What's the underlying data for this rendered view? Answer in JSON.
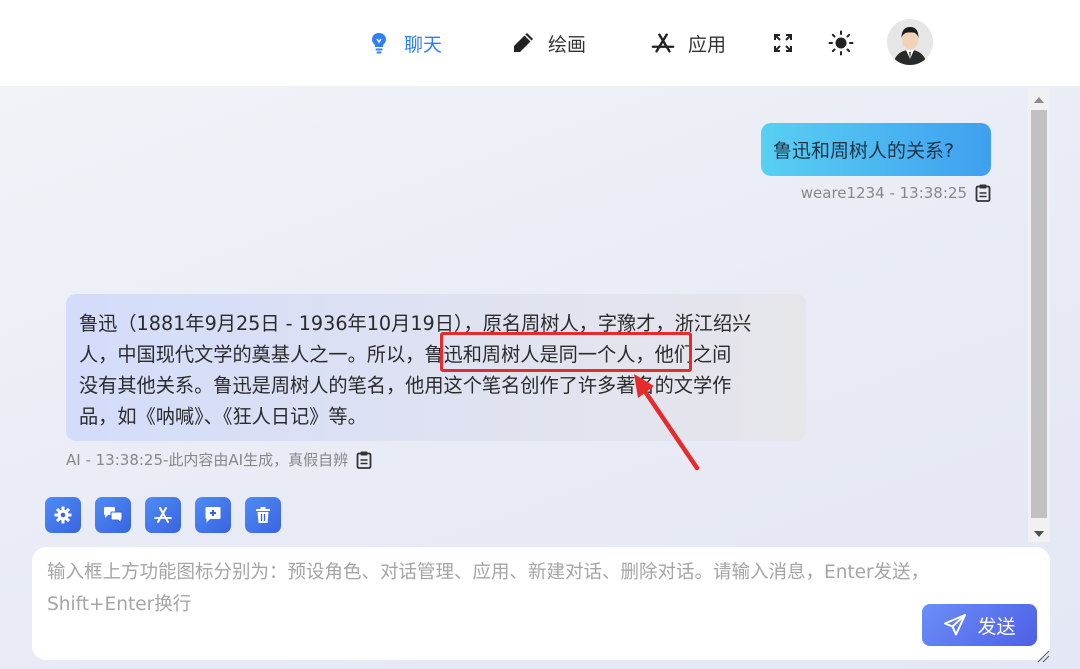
{
  "nav": {
    "chat_label": "聊天",
    "draw_label": "绘画",
    "apps_label": "应用",
    "active_color": "#2f7ff5"
  },
  "icons": {
    "chat": "lightbulb-icon",
    "draw": "pencil-icon",
    "apps": "app-store-icon",
    "fullscreen": "fullscreen-icon",
    "theme": "sun-icon",
    "copy": "clipboard-icon",
    "settings": "gear-icon",
    "conversations": "chat-bubbles-icon",
    "new_chat": "add-chat-icon",
    "delete": "trash-icon",
    "send": "paper-plane-icon"
  },
  "messages": {
    "user": {
      "text": "鲁迅和周树人的关系?",
      "meta": "weare1234 - 13:38:25"
    },
    "ai": {
      "line1": "鲁迅（1881年9月25日 - 1936年10月19日），原名周树人，字豫才，浙江绍兴",
      "line2": "人，中国现代文学的奠基人之一。所以，鲁迅和周树人是同一个人，他们之间",
      "line3": "没有其他关系。鲁迅是周树人的笔名，他用这个笔名创作了许多著名的文学作",
      "line4": "品，如《呐喊》、《狂人日记》等。",
      "meta": "AI - 13:38:25-此内容由AI生成，真假自辨"
    }
  },
  "input": {
    "placeholder_line1": "输入框上方功能图标分别为：预设角色、对话管理、应用、新建对话、删除对话。请输入消息，Enter发送，",
    "placeholder_line2": "Shift+Enter换行"
  },
  "send_label": "发送",
  "colors": {
    "user_bubble_start": "#59d0f2",
    "user_bubble_end": "#3f9ff0",
    "highlight": "#e52b2b",
    "button": "#3a63e0"
  }
}
